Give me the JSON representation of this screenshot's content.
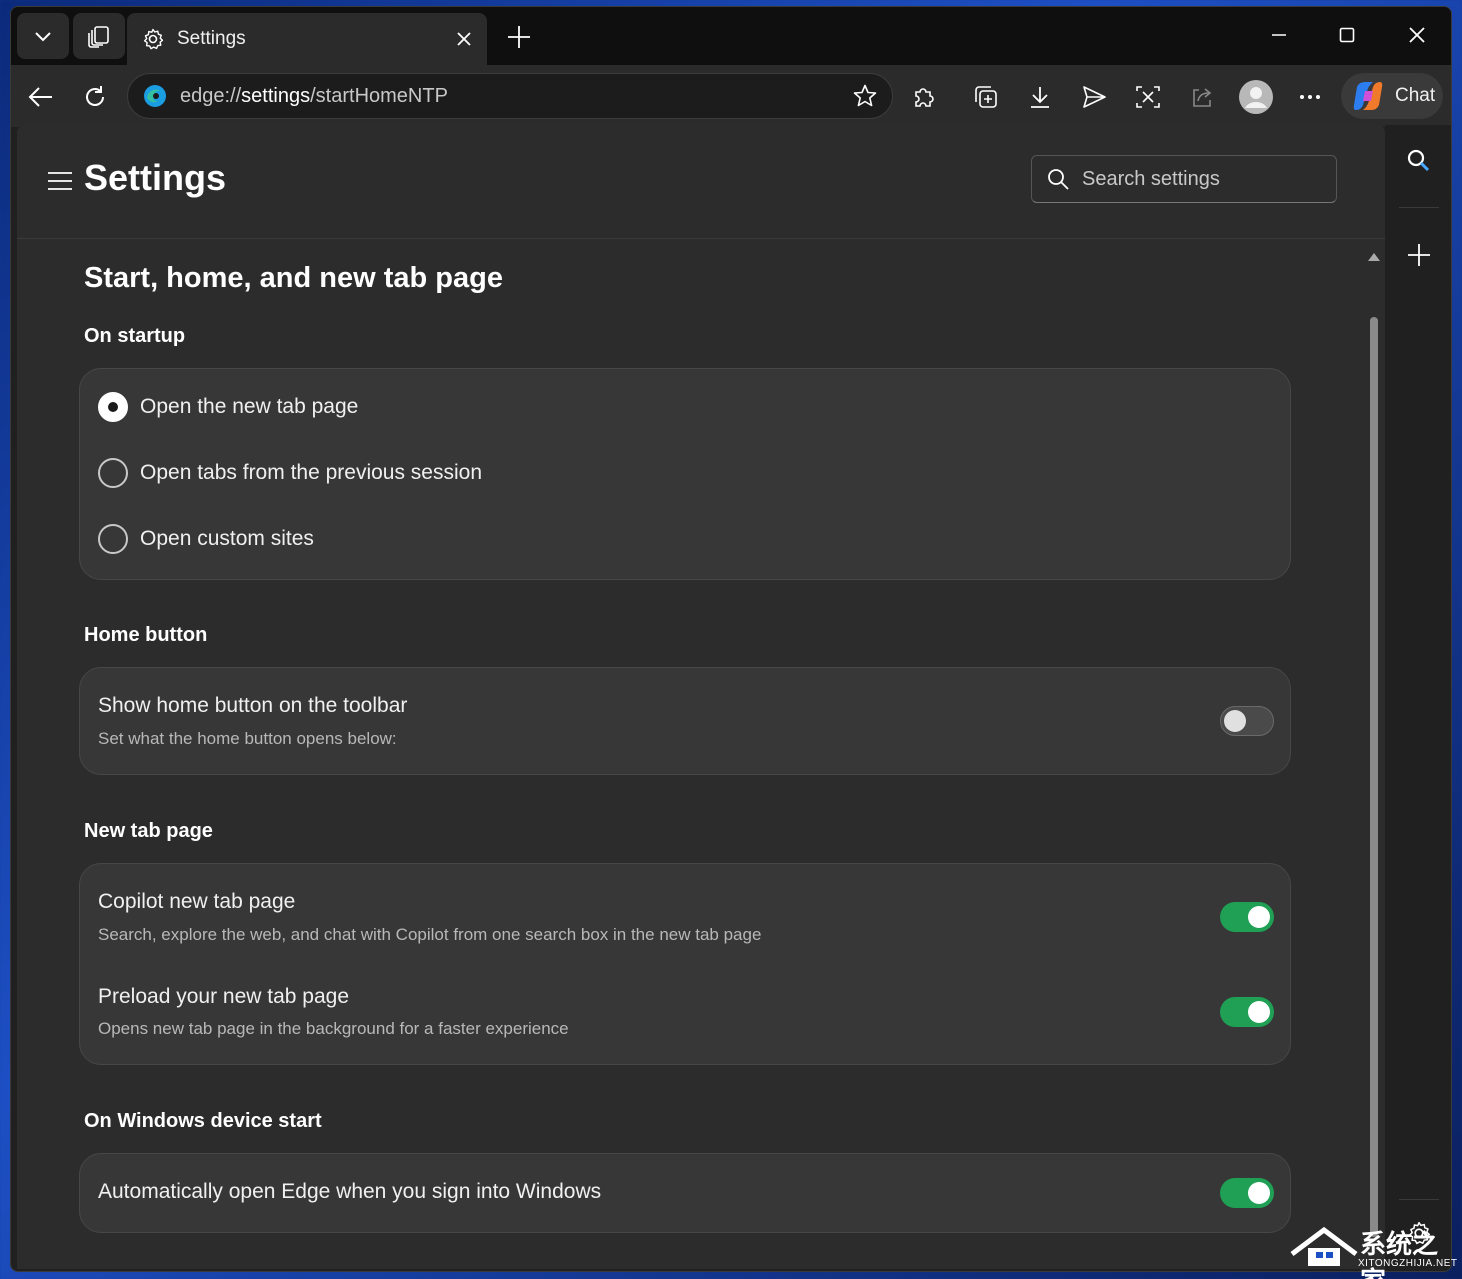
{
  "tab": {
    "title": "Settings"
  },
  "address_bar": {
    "url_prefix": "edge://",
    "url_host": "settings",
    "url_path": "/startHomeNTP"
  },
  "toolbar": {
    "chat_label": "Chat"
  },
  "header": {
    "title": "Settings",
    "search_placeholder": "Search settings"
  },
  "page": {
    "title": "Start, home, and new tab page",
    "on_startup": {
      "heading": "On startup",
      "options": [
        {
          "label": "Open the new tab page",
          "checked": true
        },
        {
          "label": "Open tabs from the previous session",
          "checked": false
        },
        {
          "label": "Open custom sites",
          "checked": false
        }
      ]
    },
    "home_button": {
      "heading": "Home button",
      "show_title": "Show home button on the toolbar",
      "show_sub": "Set what the home button opens below:",
      "enabled": false
    },
    "new_tab_page": {
      "heading": "New tab page",
      "rows": [
        {
          "title": "Copilot new tab page",
          "sub": "Search, explore the web, and chat with Copilot from one search box in the new tab page",
          "enabled": true
        },
        {
          "title": "Preload your new tab page",
          "sub": "Opens new tab page in the background for a faster experience",
          "enabled": true
        }
      ]
    },
    "windows_start": {
      "heading": "On Windows device start",
      "title": "Automatically open Edge when you sign into Windows",
      "enabled": true
    }
  },
  "watermark": {
    "text": "系统之家",
    "sub": "XITONGZHIJIA.NET"
  },
  "colors": {
    "toggle_on": "#1fa055",
    "page_bg": "#2c2c2c",
    "card_bg": "#373737"
  }
}
